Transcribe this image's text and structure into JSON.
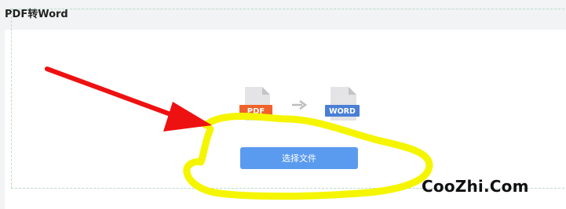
{
  "header": {
    "title": "PDF转Word"
  },
  "converter": {
    "source_format": "PDF",
    "target_format": "WORD",
    "select_button_label": "选择文件",
    "source_icon": "pdf-file-icon",
    "target_icon": "word-file-icon",
    "arrow_icon": "arrow-right-icon"
  },
  "colors": {
    "pdf": "#f0622a",
    "word": "#4a7fd6",
    "button": "#5b9bef",
    "annotation_arrow": "#ee1111",
    "annotation_highlight": "#f5f500"
  },
  "watermark": {
    "text": "CooZhi.Com"
  }
}
